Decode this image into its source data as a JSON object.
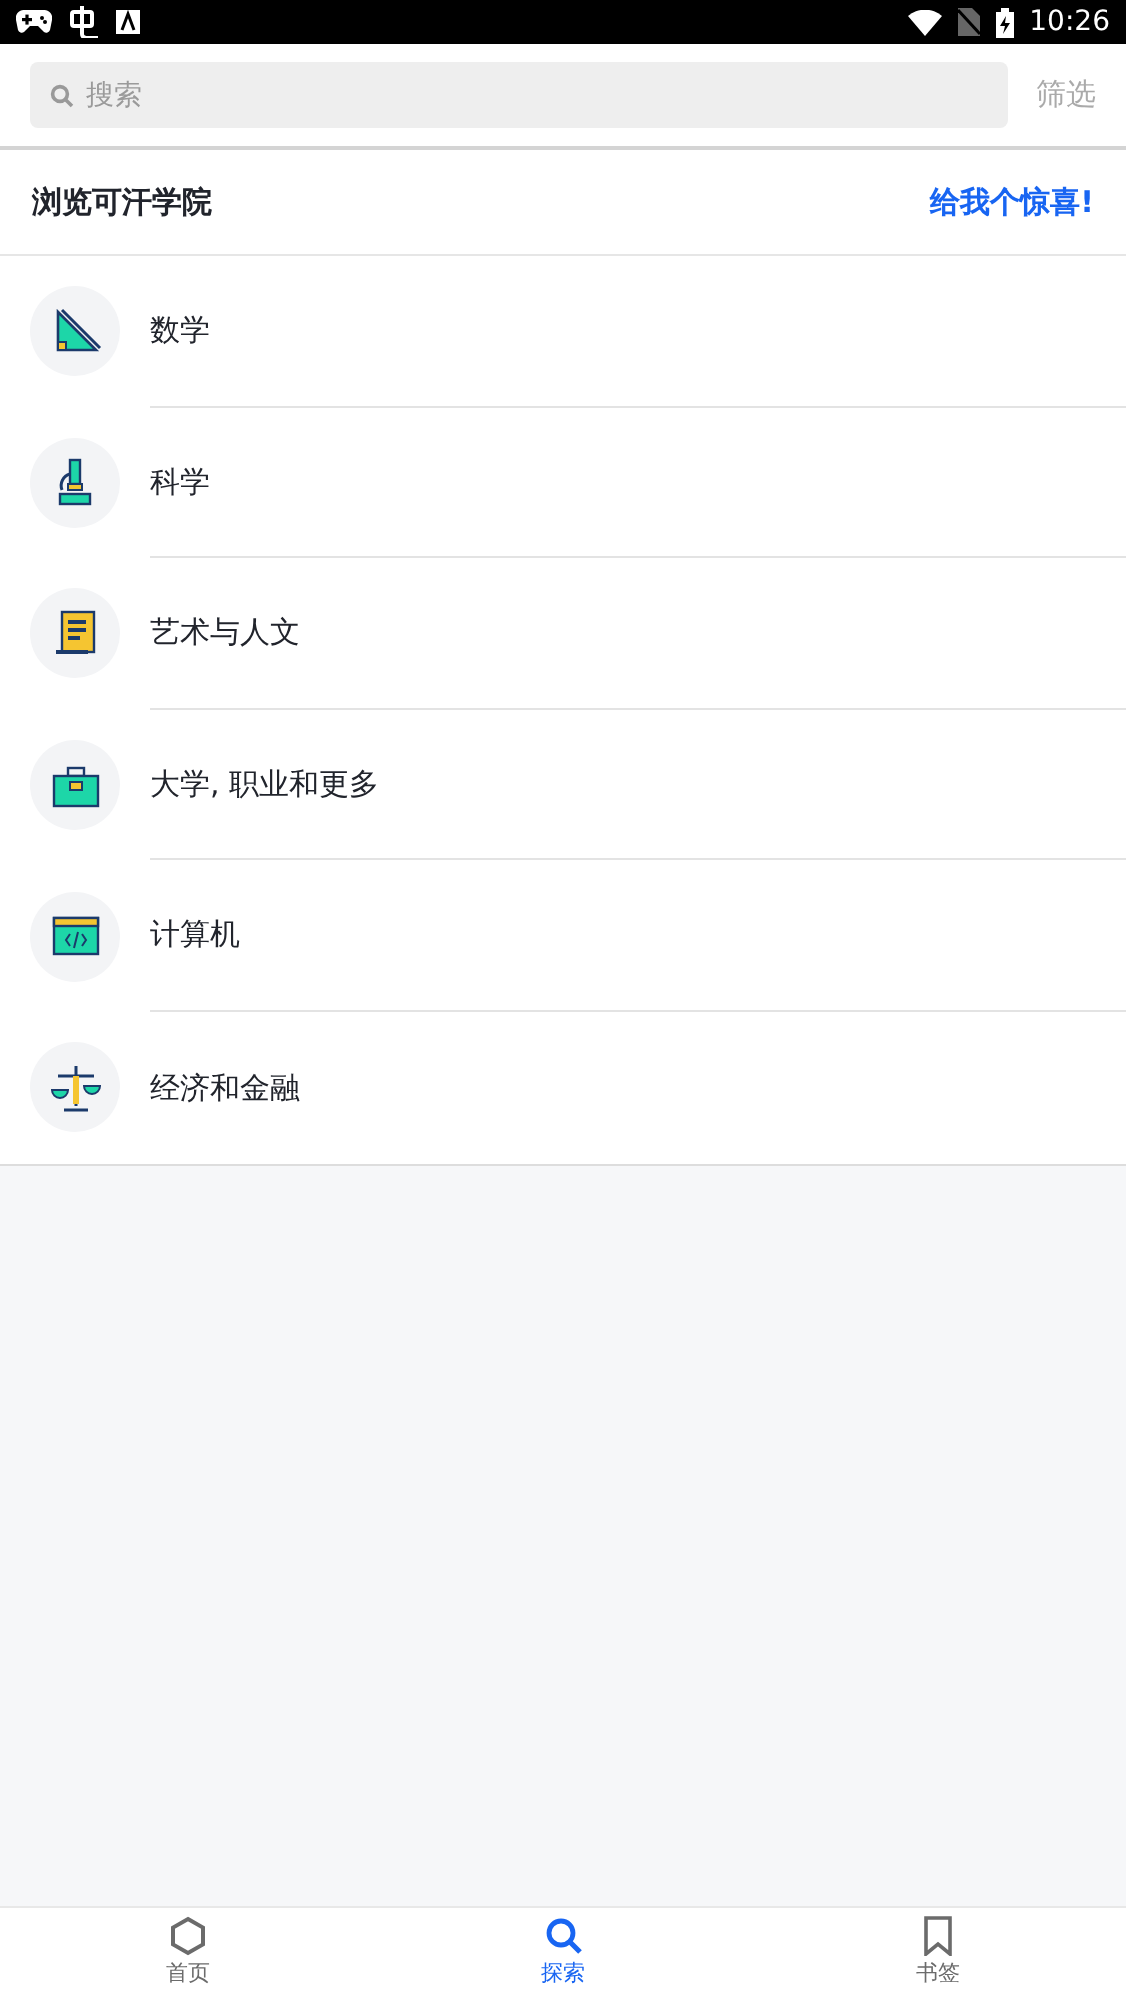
{
  "status_bar": {
    "time": "10:26"
  },
  "search": {
    "placeholder": "搜索",
    "filter": "筛选"
  },
  "header": {
    "title": "浏览可汗学院",
    "action": "给我个惊喜!"
  },
  "categories": [
    {
      "label": "数学"
    },
    {
      "label": "科学"
    },
    {
      "label": "艺术与人文"
    },
    {
      "label": "大学, 职业和更多"
    },
    {
      "label": "计算机"
    },
    {
      "label": "经济和金融"
    }
  ],
  "tabs": [
    {
      "label": "首页",
      "selected": false
    },
    {
      "label": "探索",
      "selected": true
    },
    {
      "label": "书签",
      "selected": false
    }
  ]
}
